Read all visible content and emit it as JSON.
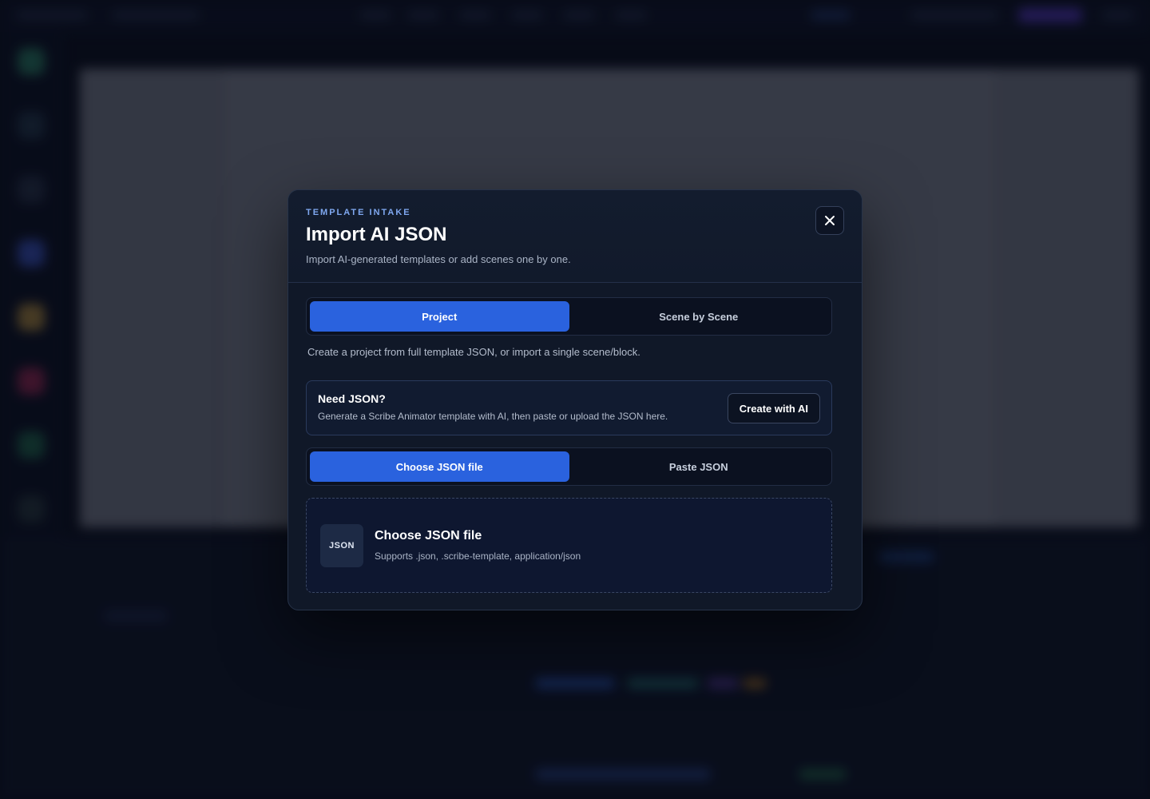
{
  "modal": {
    "eyebrow": "TEMPLATE INTAKE",
    "title": "Import AI JSON",
    "subtitle": "Import AI-generated templates or add scenes one by one.",
    "close_icon": "close-icon"
  },
  "mode_tabs": {
    "items": [
      {
        "label": "Project",
        "active": true
      },
      {
        "label": "Scene by Scene",
        "active": false
      }
    ]
  },
  "helper_text": "Create a project from full template JSON, or import a single scene/block.",
  "need_json": {
    "title": "Need JSON?",
    "description": "Generate a Scribe Animator template with AI, then paste or upload the JSON here.",
    "button_label": "Create with AI"
  },
  "source_tabs": {
    "items": [
      {
        "label": "Choose JSON file",
        "active": true
      },
      {
        "label": "Paste JSON",
        "active": false
      }
    ]
  },
  "dropzone": {
    "badge": "JSON",
    "title": "Choose JSON file",
    "subtitle": "Supports .json, .scribe-template, application/json"
  },
  "colors": {
    "accent": "#2a62de",
    "eyebrow": "#7fa8f0",
    "modal_bg": "#101828"
  }
}
